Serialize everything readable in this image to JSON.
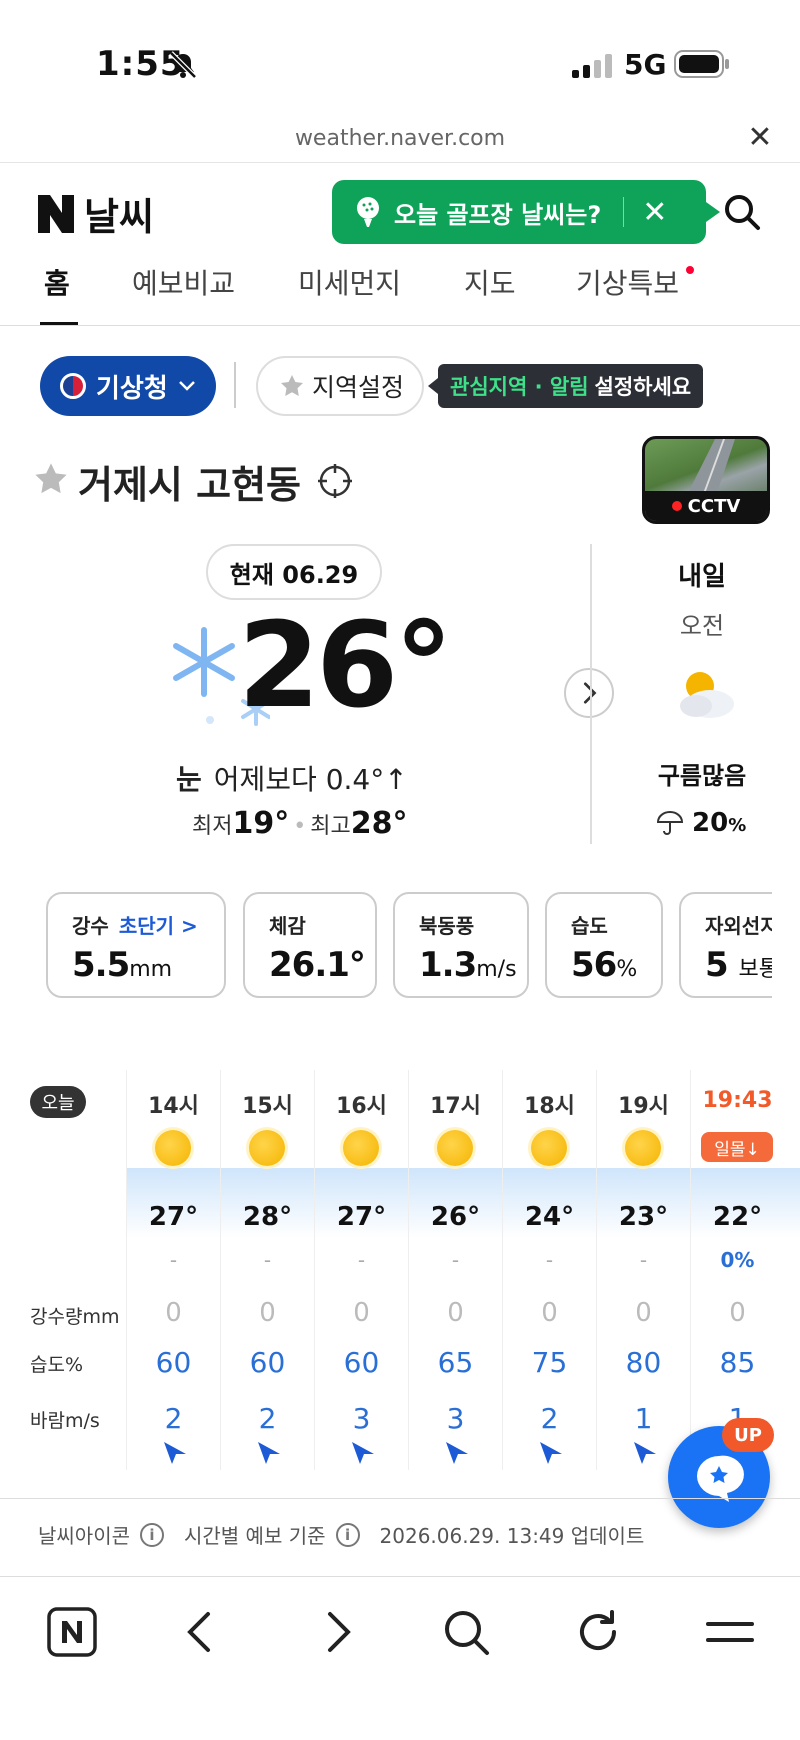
{
  "status_bar": {
    "time": "1:55",
    "network": "5G"
  },
  "browser": {
    "url": "weather.naver.com"
  },
  "header": {
    "logo_text": "날씨",
    "golf_banner": "오늘 골프장 날씨는?",
    "tabs": [
      {
        "label": "홈",
        "active": true
      },
      {
        "label": "예보비교"
      },
      {
        "label": "미세먼지"
      },
      {
        "label": "지도"
      },
      {
        "label": "기상특보",
        "has_dot": true
      }
    ]
  },
  "source": {
    "provider": "기상청",
    "region_button": "지역설정",
    "tip_highlight": "관심지역 · 알림",
    "tip_text": "설정하세요"
  },
  "location": {
    "name": "거제시 고현동",
    "cctv_label": "CCTV"
  },
  "current": {
    "date_label": "현재 06.29",
    "temperature": "26°",
    "condition": "눈",
    "compare": "어제보다 0.4°↑",
    "min_label": "최저",
    "min": "19°",
    "max_label": "최고",
    "max": "28°"
  },
  "tomorrow": {
    "title": "내일",
    "period": "오전",
    "condition": "구름많음",
    "rain_prob": "20",
    "rain_unit": "%"
  },
  "cards": [
    {
      "label": "강수",
      "link": "초단기 >",
      "value": "5.5",
      "unit": "mm"
    },
    {
      "label": "체감",
      "value": "26.1°",
      "unit": ""
    },
    {
      "label": "북동풍",
      "value": "1.3",
      "unit": "m/s"
    },
    {
      "label": "습도",
      "value": "56",
      "unit": "%"
    },
    {
      "label": "자외선지",
      "value": "5",
      "unit": "보통"
    }
  ],
  "hourly": {
    "today_badge": "오늘",
    "row_labels": {
      "rain": "강수량mm",
      "humidity": "습도%",
      "wind": "바람m/s"
    },
    "hours": [
      {
        "time": "14시",
        "temp": "27°",
        "precip_prob": "-",
        "rain": "0",
        "humidity": "60",
        "wind": "2"
      },
      {
        "time": "15시",
        "temp": "28°",
        "precip_prob": "-",
        "rain": "0",
        "humidity": "60",
        "wind": "2"
      },
      {
        "time": "16시",
        "temp": "27°",
        "precip_prob": "-",
        "rain": "0",
        "humidity": "60",
        "wind": "3"
      },
      {
        "time": "17시",
        "temp": "26°",
        "precip_prob": "-",
        "rain": "0",
        "humidity": "65",
        "wind": "3"
      },
      {
        "time": "18시",
        "temp": "24°",
        "precip_prob": "-",
        "rain": "0",
        "humidity": "75",
        "wind": "2"
      },
      {
        "time": "19시",
        "temp": "23°",
        "precip_prob": "-",
        "rain": "0",
        "humidity": "80",
        "wind": "1"
      },
      {
        "time": "19:43",
        "sunset_label": "일몰↓",
        "temp": "22°",
        "precip_prob": "0%",
        "rain": "0",
        "humidity": "85",
        "wind": "1"
      }
    ]
  },
  "footer": {
    "icon_label": "날씨아이콘",
    "basis_label": "시간별 예보 기준",
    "updated": "2026.06.29. 13:49 업데이트"
  },
  "fab": {
    "badge": "UP"
  },
  "colors": {
    "brand_green": "#0fa35a",
    "provider_blue": "#1149a8",
    "value_blue": "#2a6fd6",
    "sunset_orange": "#f25a2a"
  }
}
